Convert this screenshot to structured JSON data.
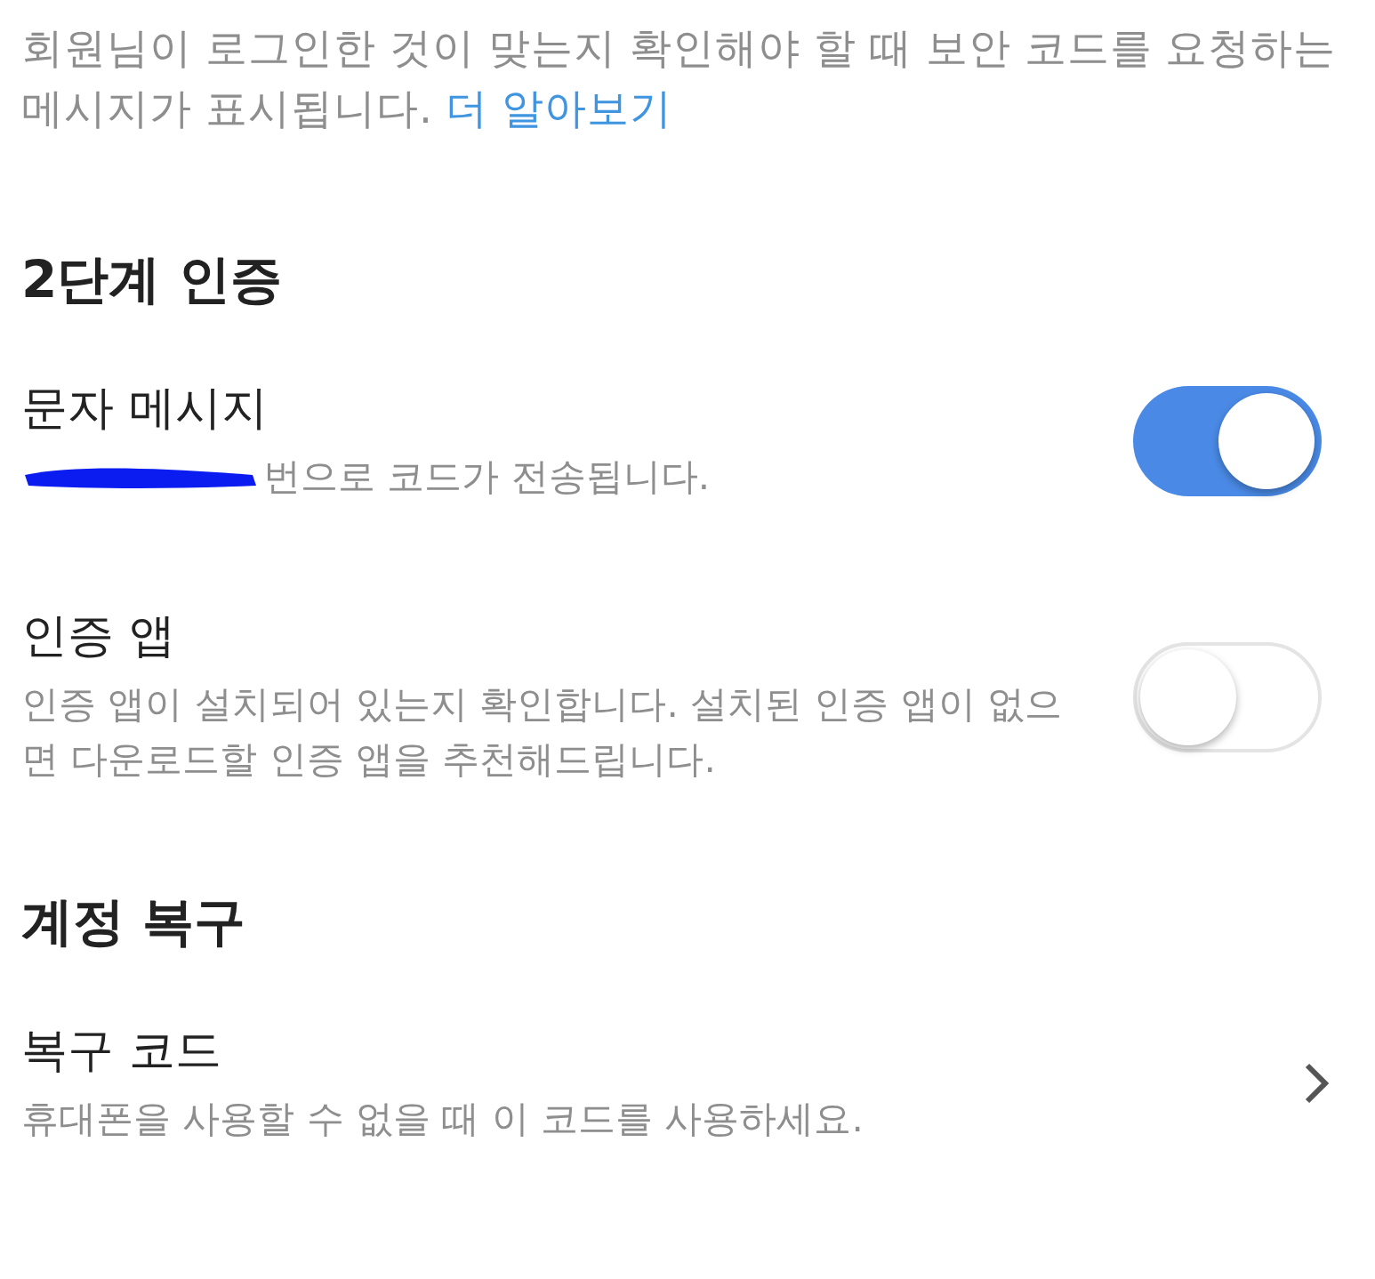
{
  "intro": {
    "text": "회원님이 로그인한 것이 맞는지 확인해야 할 때 보안 코드를 요청하는 메시지가 표시됩니다.",
    "link": "더 알아보기"
  },
  "sections": [
    {
      "title": "2단계 인증",
      "items": [
        {
          "kind": "toggle",
          "title": "문자 메시지",
          "subtitle": "번으로 코드가 전송됩니다.",
          "redacted": true,
          "on": true
        },
        {
          "kind": "toggle",
          "title": "인증 앱",
          "subtitle": "인증 앱이 설치되어 있는지 확인합니다. 설치된 인증 앱이 없으면 다운로드할 인증 앱을 추천해드립니다.",
          "on": false
        }
      ]
    },
    {
      "title": "계정 복구",
      "items": [
        {
          "kind": "link",
          "title": "복구 코드",
          "subtitle": "휴대폰을 사용할 수 없을 때 이 코드를 사용하세요."
        }
      ]
    }
  ]
}
